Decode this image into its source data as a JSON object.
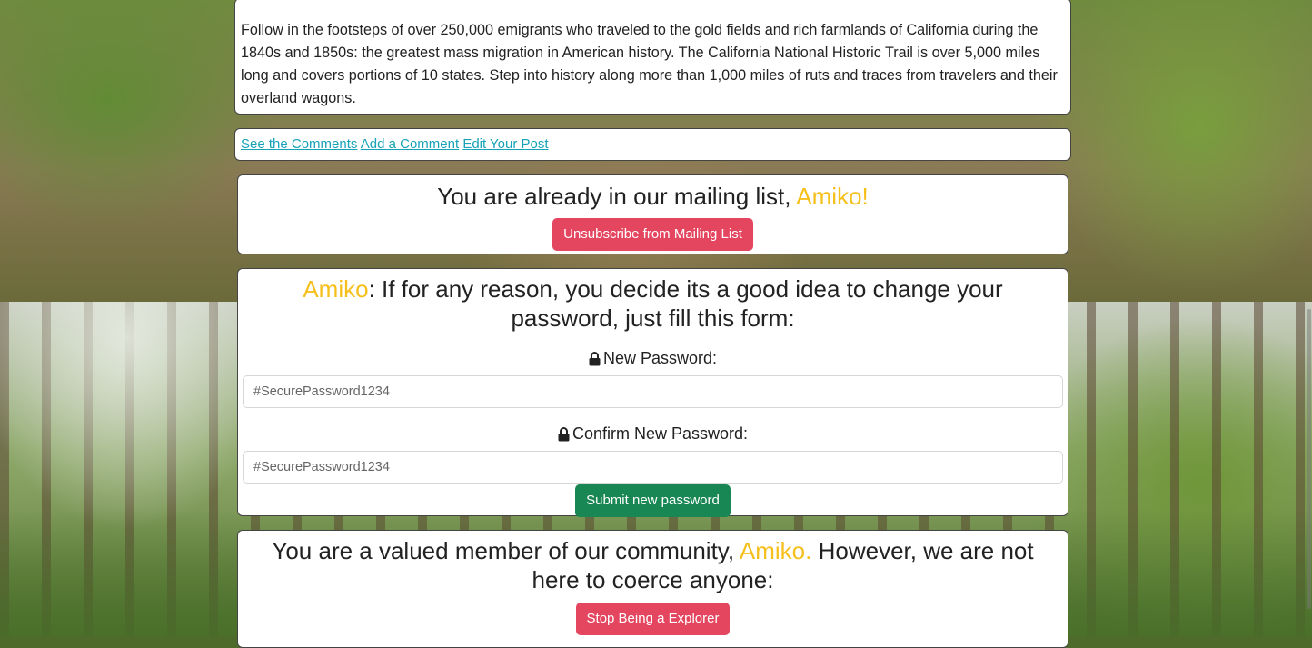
{
  "post": {
    "description": "Follow in the footsteps of over 250,000 emigrants who traveled to the gold fields and rich farmlands of California during the 1840s and 1850s: the greatest mass migration in American history. The California National Historic Trail is over 5,000 miles long and covers portions of 10 states. Step into history along more than 1,000 miles of ruts and traces from travelers and their overland wagons."
  },
  "post_links": {
    "see_comments": "See the Comments",
    "add_comment": "Add a Comment",
    "edit_post": "Edit Your Post"
  },
  "mailing": {
    "message": "You are already in our mailing list,",
    "username": "Amiko!",
    "unsubscribe_label": "Unsubscribe from Mailing List"
  },
  "password_form": {
    "username": "Amiko",
    "heading": ": If for any reason, you decide its a good idea to change your password, just fill this form:",
    "new_label": "New Password:",
    "new_placeholder": "#SecurePassword1234",
    "confirm_label": "Confirm New Password:",
    "confirm_placeholder": "#SecurePassword1234",
    "submit_label": "Submit new password"
  },
  "membership": {
    "message_start": "You are a valued member of our community,",
    "username": "Amiko.",
    "message_end": "However, we are not here to coerce anyone:",
    "stop_label": "Stop Being a Explorer"
  },
  "colors": {
    "highlight": "#f6c01c",
    "link": "#17a2b8",
    "danger": "#e44660",
    "success": "#198754"
  },
  "icons": {
    "lock": "lock-icon"
  }
}
